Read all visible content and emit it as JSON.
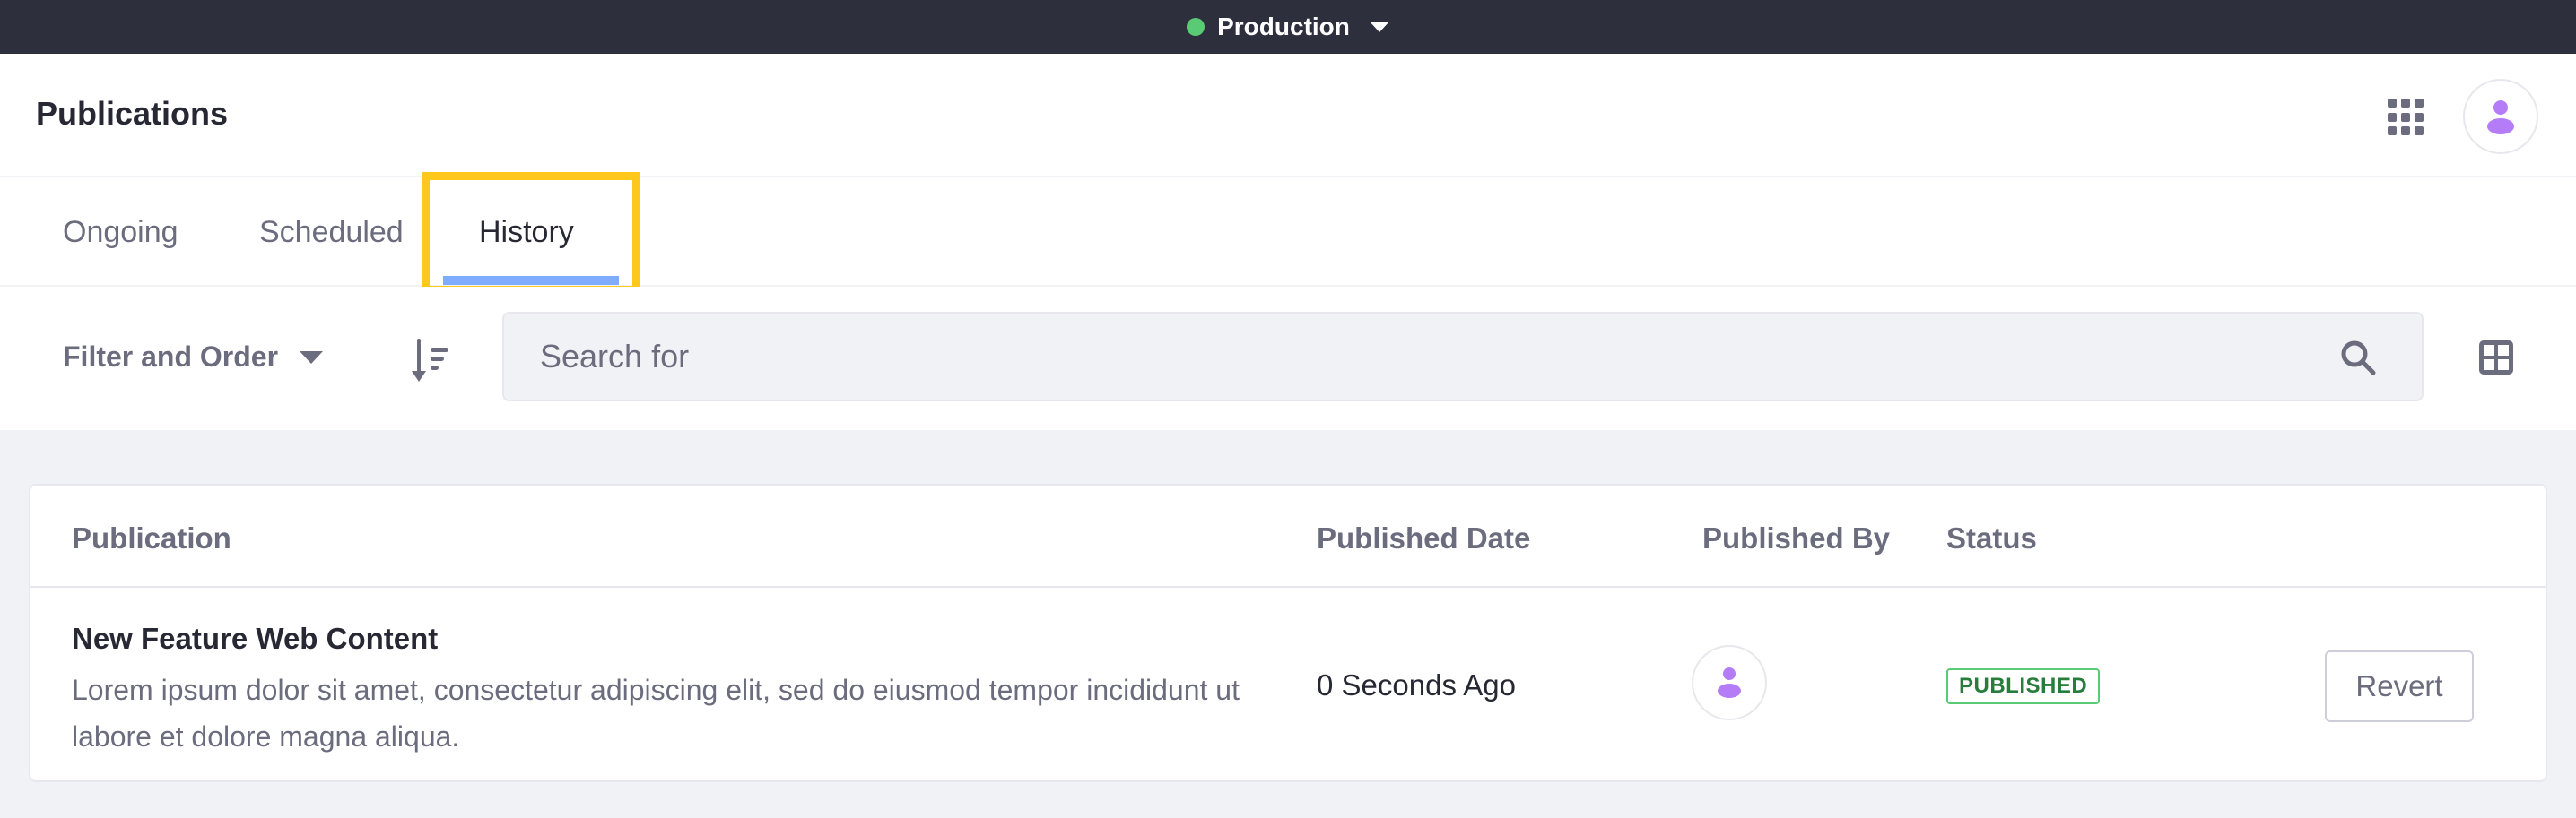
{
  "topbar": {
    "environment_label": "Production",
    "environment_status_color": "#5aca75"
  },
  "header": {
    "title": "Publications",
    "apps_icon": "apps-grid-icon",
    "user_icon": "user-icon"
  },
  "tabs": [
    {
      "label": "Ongoing",
      "active": false
    },
    {
      "label": "Scheduled",
      "active": false
    },
    {
      "label": "History",
      "active": true
    }
  ],
  "toolbar": {
    "filter_label": "Filter and Order",
    "sort_icon": "sort-order-icon",
    "search_placeholder": "Search for",
    "search_value": "",
    "view_icon": "card-view-icon"
  },
  "table": {
    "columns": [
      "Publication",
      "Published Date",
      "Published By",
      "Status"
    ],
    "rows": [
      {
        "title": "New Feature Web Content",
        "description": "Lorem ipsum dolor sit amet, consectetur adipiscing elit, sed do eiusmod tempor incididunt ut labore et dolore magna aliqua.",
        "published_date": "0 Seconds Ago",
        "published_by_icon": "user-icon",
        "status": "PUBLISHED",
        "action_label": "Revert"
      }
    ]
  },
  "colors": {
    "accent_underline": "#80acff",
    "highlight": "#fdc81b",
    "avatar": "#b57cf7",
    "status_published_border": "#5aca75",
    "status_published_text": "#287d3c"
  }
}
